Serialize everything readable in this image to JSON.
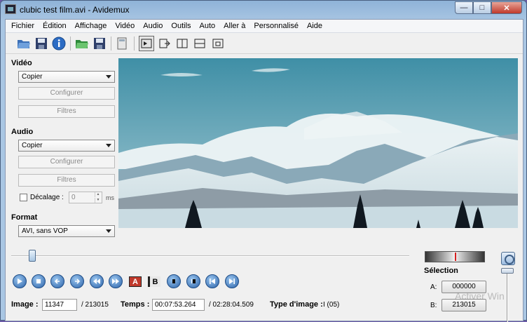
{
  "window": {
    "title": "clubic test film.avi - Avidemux"
  },
  "menu": [
    "Fichier",
    "Édition",
    "Affichage",
    "Vidéo",
    "Audio",
    "Outils",
    "Auto",
    "Aller à",
    "Personnalisé",
    "Aide"
  ],
  "video": {
    "section": "Vidéo",
    "codec": "Copier",
    "configure": "Configurer",
    "filters": "Filtres"
  },
  "audio": {
    "section": "Audio",
    "codec": "Copier",
    "configure": "Configurer",
    "filters": "Filtres",
    "shift_label": "Décalage :",
    "shift_value": "0",
    "shift_unit": "ms"
  },
  "format": {
    "section": "Format",
    "value": "AVI, sans VOP"
  },
  "markers": {
    "a": "A",
    "b": "B"
  },
  "status": {
    "image_label": "Image :",
    "image_value": "11347",
    "image_total": "/ 213015",
    "time_label": "Temps :",
    "time_value": "00:07:53.264",
    "time_total": "/ 02:28:04.509",
    "type_label": "Type d'image :",
    "type_value": "I (05)"
  },
  "selection": {
    "title": "Sélection",
    "a_label": "A:",
    "a_value": "000000",
    "b_label": "B:",
    "b_value": "213015"
  },
  "playback": {
    "position": 0.053
  },
  "watermark": "Activer Win"
}
